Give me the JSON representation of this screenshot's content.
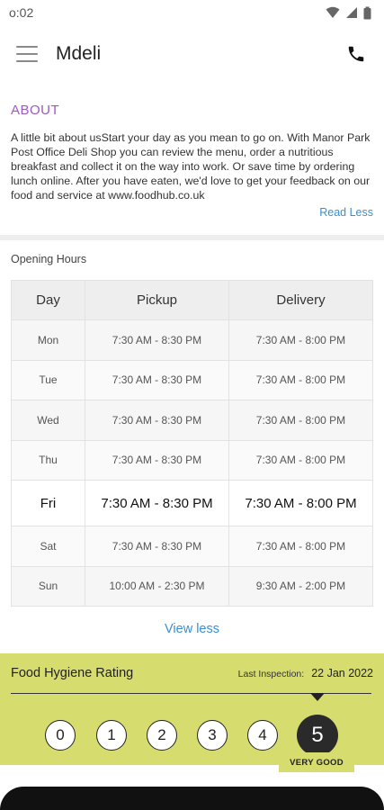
{
  "status": {
    "time": "o:02"
  },
  "app": {
    "title": "Mdeli",
    "menu_icon": "hamburger-icon",
    "call_icon": "phone-icon"
  },
  "about": {
    "heading": "ABOUT",
    "text": "A little bit about usStart your day as you mean to go on. With Manor Park Post Office Deli Shop you can review the menu, order a nutritious breakfast and collect it on the way into work. Or save time by ordering lunch online. After you have eaten, we'd love to get your feedback on our food and service at www.foodhub.co.uk",
    "read_less": "Read Less"
  },
  "hours": {
    "title": "Opening Hours",
    "headers": [
      "Day",
      "Pickup",
      "Delivery"
    ],
    "rows": [
      {
        "day": "Mon",
        "pickup": "7:30 AM - 8:30 PM",
        "delivery": "7:30 AM - 8:00 PM"
      },
      {
        "day": "Tue",
        "pickup": "7:30 AM - 8:30 PM",
        "delivery": "7:30 AM - 8:00 PM"
      },
      {
        "day": "Wed",
        "pickup": "7:30 AM - 8:30 PM",
        "delivery": "7:30 AM - 8:00 PM"
      },
      {
        "day": "Thu",
        "pickup": "7:30 AM - 8:30 PM",
        "delivery": "7:30 AM - 8:00 PM"
      },
      {
        "day": "Fri",
        "pickup": "7:30 AM - 8:30 PM",
        "delivery": "7:30 AM - 8:00 PM"
      },
      {
        "day": "Sat",
        "pickup": "7:30 AM - 8:30 PM",
        "delivery": "7:30 AM - 8:00 PM"
      },
      {
        "day": "Sun",
        "pickup": "10:00 AM - 2:30 PM",
        "delivery": "9:30 AM - 2:00 PM"
      }
    ],
    "view_less": "View less"
  },
  "hygiene": {
    "title": "Food Hygiene Rating",
    "inspection_label": "Last Inspection:",
    "inspection_date": "22 Jan 2022",
    "scores": [
      "0",
      "1",
      "2",
      "3",
      "4",
      "5"
    ],
    "selected": 5,
    "verdict": "VERY GOOD",
    "accent": "#d6dc6e"
  }
}
